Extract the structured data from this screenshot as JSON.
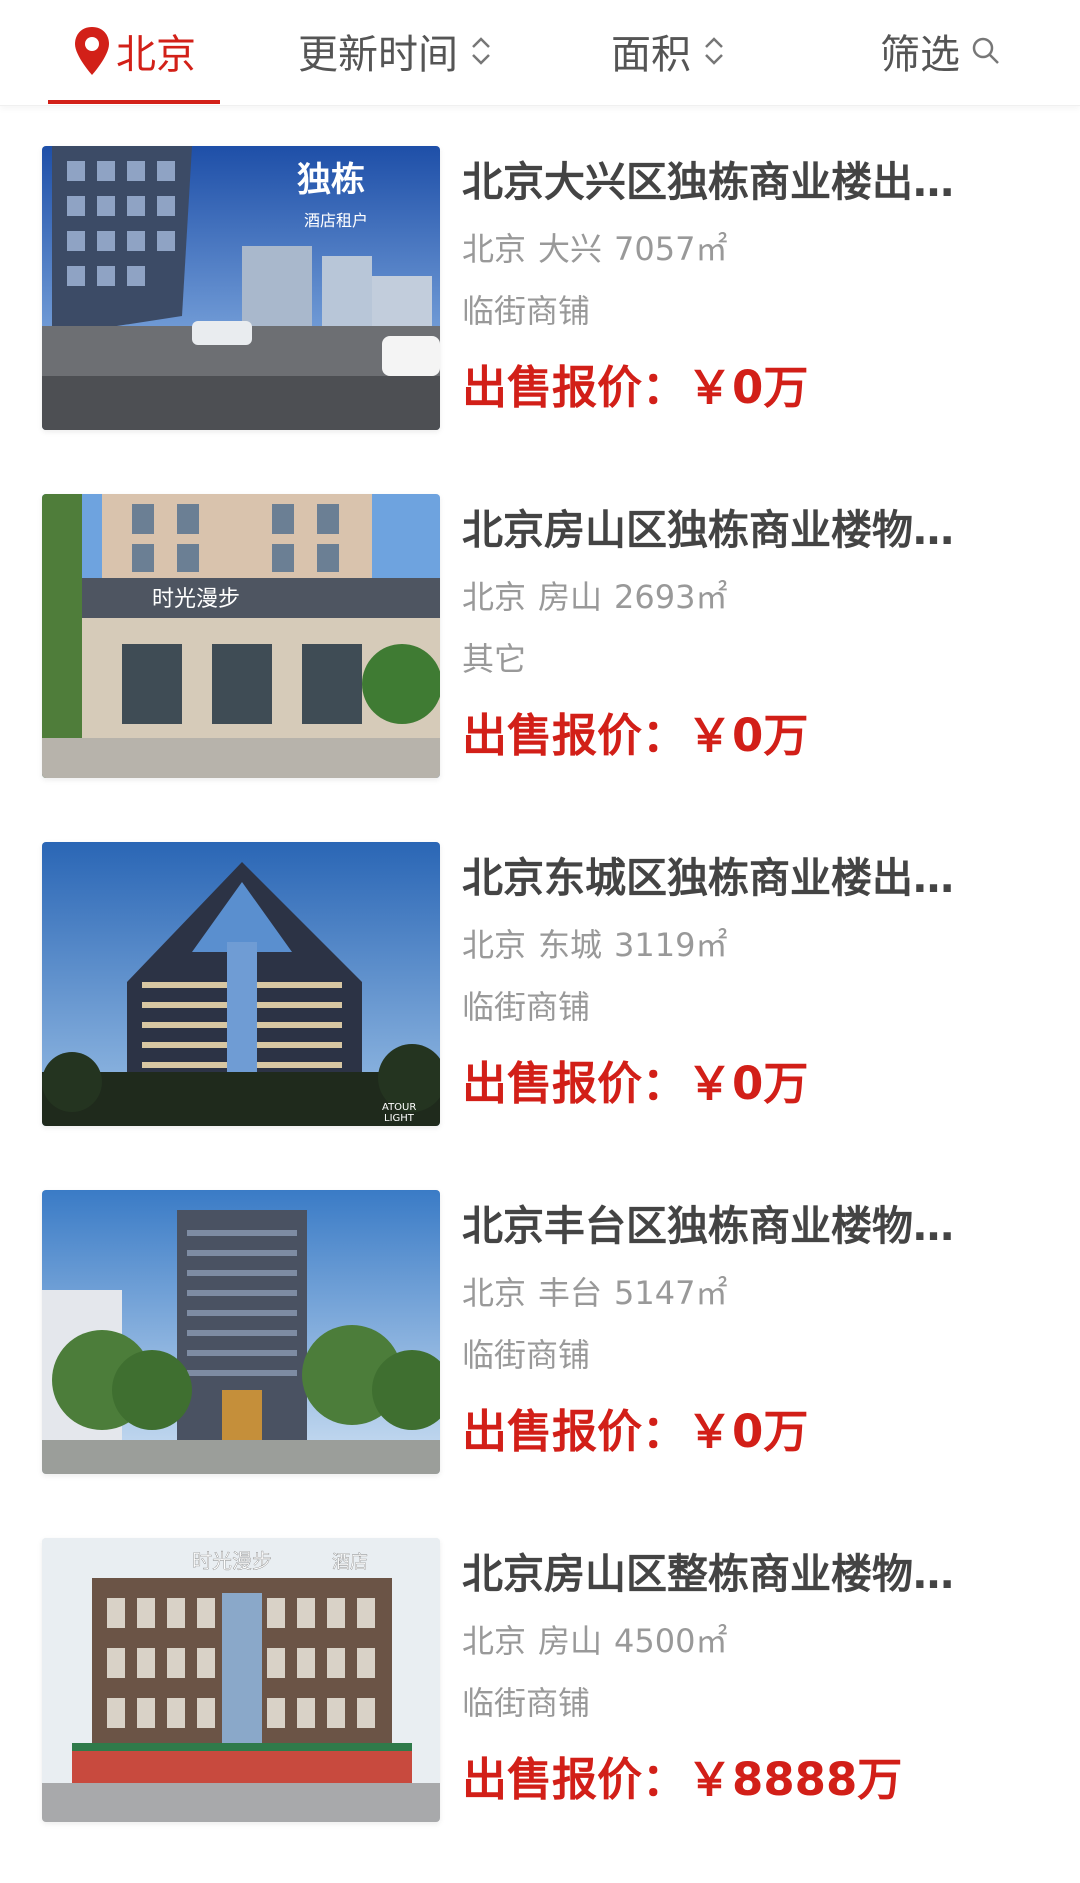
{
  "topbar": {
    "city": "北京",
    "sort_time_label": "更新时间",
    "sort_area_label": "面积",
    "filter_label": "筛选"
  },
  "colors": {
    "accent": "#d22018",
    "price": "#d21f18",
    "meta": "#999999"
  },
  "listings": [
    {
      "title": "北京大兴区独栋商业楼出…",
      "city": "北京",
      "district": "大兴",
      "area": "7057㎡",
      "type": "临街商铺",
      "price_label": "出售报价：",
      "price": "￥0万",
      "image_text": [
        "独栋",
        "酒店租户"
      ]
    },
    {
      "title": "北京房山区独栋商业楼物…",
      "city": "北京",
      "district": "房山",
      "area": "2693㎡",
      "type": "其它",
      "price_label": "出售报价：",
      "price": "￥0万",
      "image_text": [
        "时光漫步"
      ]
    },
    {
      "title": "北京东城区独栋商业楼出…",
      "city": "北京",
      "district": "东城",
      "area": "3119㎡",
      "type": "临街商铺",
      "price_label": "出售报价：",
      "price": "￥0万",
      "image_text": [
        "ATOUR",
        "LIGHT"
      ]
    },
    {
      "title": "北京丰台区独栋商业楼物…",
      "city": "北京",
      "district": "丰台",
      "area": "5147㎡",
      "type": "临街商铺",
      "price_label": "出售报价：",
      "price": "￥0万",
      "image_text": []
    },
    {
      "title": "北京房山区整栋商业楼物…",
      "city": "北京",
      "district": "房山",
      "area": "4500㎡",
      "type": "临街商铺",
      "price_label": "出售报价：",
      "price": "￥8888万",
      "image_text": [
        "时光漫步",
        "酒店"
      ]
    }
  ]
}
